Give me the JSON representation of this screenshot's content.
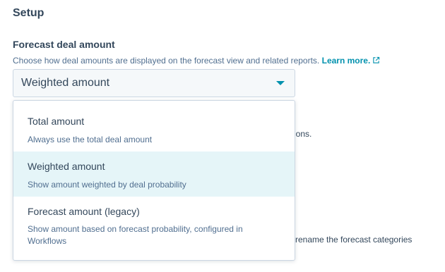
{
  "setup": {
    "title": "Setup",
    "forecast_field": {
      "label": "Forecast deal amount",
      "help_text": "Choose how deal amounts are displayed on the forecast view and related reports.",
      "learn_more": "Learn more.",
      "selected_value": "Weighted amount"
    },
    "background_fragments": [
      "ssions.",
      "or rename the forecast categories"
    ],
    "dropdown": {
      "options": [
        {
          "label": "Total amount",
          "description": "Always use the total deal amount",
          "highlighted": false
        },
        {
          "label": "Weighted amount",
          "description": "Show amount weighted by deal probability",
          "highlighted": true
        },
        {
          "label": "Forecast amount (legacy)",
          "description": "Show amount based on forecast probability, configured in Workflows",
          "highlighted": false
        }
      ]
    }
  },
  "colors": {
    "text": "#33475b",
    "subtext": "#516f90",
    "link": "#0091ae",
    "highlight": "#e5f5f8",
    "border": "#cbd6e2"
  },
  "icons": {
    "external_link": "external-link-icon",
    "caret": "caret-down-icon"
  }
}
